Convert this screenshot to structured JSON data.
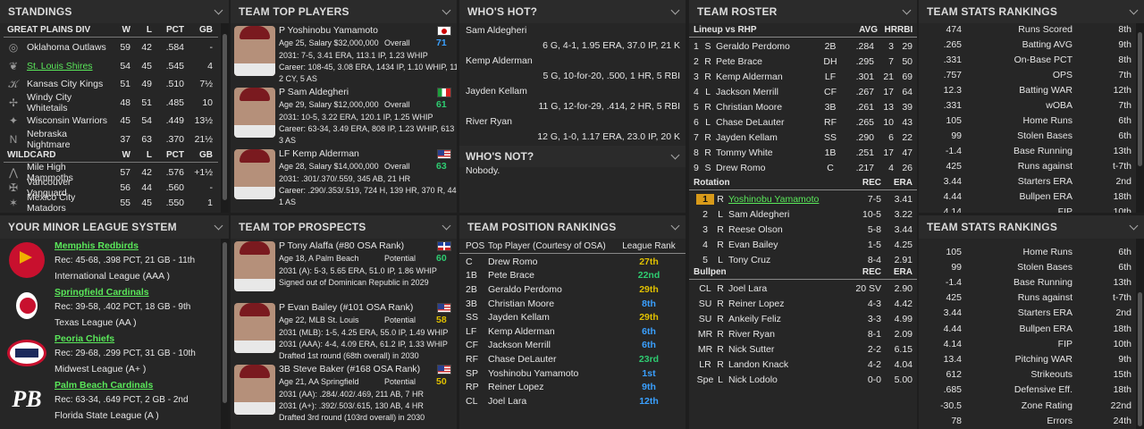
{
  "standings": {
    "title": "STANDINGS",
    "div_header": {
      "name": "GREAT PLAINS DIV",
      "w": "W",
      "l": "L",
      "pct": "PCT",
      "gb": "GB"
    },
    "div_rows": [
      {
        "team": "Oklahoma Outlaws",
        "w": "59",
        "l": "42",
        "pct": ".584",
        "gb": "-"
      },
      {
        "team": "St. Louis Shires",
        "w": "54",
        "l": "45",
        "pct": ".545",
        "gb": "4"
      },
      {
        "team": "Kansas City Kings",
        "w": "51",
        "l": "49",
        "pct": ".510",
        "gb": "7½"
      },
      {
        "team": "Windy City Whitetails",
        "w": "48",
        "l": "51",
        "pct": ".485",
        "gb": "10"
      },
      {
        "team": "Wisconsin Warriors",
        "w": "45",
        "l": "54",
        "pct": ".449",
        "gb": "13½"
      },
      {
        "team": "Nebraska Nightmare",
        "w": "37",
        "l": "63",
        "pct": ".370",
        "gb": "21½"
      }
    ],
    "wc_header": {
      "name": "WILDCARD",
      "w": "W",
      "l": "L",
      "pct": "PCT",
      "gb": "GB"
    },
    "wc_rows": [
      {
        "team": "Mile High Mammoths",
        "w": "57",
        "l": "42",
        "pct": ".576",
        "gb": "+1½"
      },
      {
        "team": "Vancouver Vanguard",
        "w": "56",
        "l": "44",
        "pct": ".560",
        "gb": "-"
      },
      {
        "team": "Mexico City Matadors",
        "w": "55",
        "l": "45",
        "pct": ".550",
        "gb": "1"
      }
    ]
  },
  "top_players": {
    "title": "TEAM TOP PLAYERS",
    "players": [
      {
        "name": "P Yoshinobu Yamamoto",
        "info": "Age 25, Salary $32,000,000",
        "ovl": "Overall",
        "rating": "71",
        "line1": "2031: 7-5, 3.41 ERA, 113.1 IP, 1.23 WHIP",
        "line2": "Career: 108-45, 3.08 ERA, 1434 IP, 1.10 WHIP, 1160",
        "line3": "2 CY, 5 AS"
      },
      {
        "name": "P Sam Aldegheri",
        "info": "Age 29, Salary $12,000,000",
        "ovl": "Overall",
        "rating": "61",
        "line1": "2031: 10-5, 3.22 ERA, 120.1 IP, 1.25 WHIP",
        "line2": "Career: 63-34, 3.49 ERA, 808 IP, 1.23 WHIP, 613 K",
        "line3": "3 AS"
      },
      {
        "name": "LF Kemp Alderman",
        "info": "Age 28, Salary $14,000,000",
        "ovl": "Overall",
        "rating": "63",
        "line1": "2031: .301/.370/.559, 345 AB, 21 HR",
        "line2": "Career: .290/.353/.519, 724 H, 139 HR, 370 R, 448 R",
        "line3": "1 AS"
      }
    ]
  },
  "whos_hot": {
    "title": "WHO'S HOT?",
    "entries": [
      {
        "name": "Sam Aldegheri",
        "stats": "6 G, 4-1, 1.95 ERA, 37.0 IP, 21 K"
      },
      {
        "name": "Kemp Alderman",
        "stats": "5 G, 10-for-20, .500, 1 HR, 5 RBI"
      },
      {
        "name": "Jayden Kellam",
        "stats": "11 G, 12-for-29, .414, 2 HR, 5 RBI"
      },
      {
        "name": "River Ryan",
        "stats": "12 G, 1-0, 1.17 ERA, 23.0 IP, 20 K"
      }
    ],
    "not_title": "WHO'S NOT?",
    "not_text": "Nobody."
  },
  "roster": {
    "title": "TEAM ROSTER",
    "lineup_header": {
      "label": "Lineup vs RHP",
      "avg": "AVG",
      "hr": "HR",
      "rbi": "RBI"
    },
    "lineup": [
      {
        "n": "1",
        "h": "S",
        "name": "Geraldo Perdomo",
        "pos": "2B",
        "avg": ".284",
        "hr": "3",
        "rbi": "29"
      },
      {
        "n": "2",
        "h": "R",
        "name": "Pete Brace",
        "pos": "DH",
        "avg": ".295",
        "hr": "7",
        "rbi": "50"
      },
      {
        "n": "3",
        "h": "R",
        "name": "Kemp Alderman",
        "pos": "LF",
        "avg": ".301",
        "hr": "21",
        "rbi": "69"
      },
      {
        "n": "4",
        "h": "L",
        "name": "Jackson Merrill",
        "pos": "CF",
        "avg": ".267",
        "hr": "17",
        "rbi": "64"
      },
      {
        "n": "5",
        "h": "R",
        "name": "Christian Moore",
        "pos": "3B",
        "avg": ".261",
        "hr": "13",
        "rbi": "39"
      },
      {
        "n": "6",
        "h": "L",
        "name": "Chase DeLauter",
        "pos": "RF",
        "avg": ".265",
        "hr": "10",
        "rbi": "43"
      },
      {
        "n": "7",
        "h": "R",
        "name": "Jayden Kellam",
        "pos": "SS",
        "avg": ".290",
        "hr": "6",
        "rbi": "22"
      },
      {
        "n": "8",
        "h": "R",
        "name": "Tommy White",
        "pos": "1B",
        "avg": ".251",
        "hr": "17",
        "rbi": "47"
      },
      {
        "n": "9",
        "h": "S",
        "name": "Drew Romo",
        "pos": "C",
        "avg": ".217",
        "hr": "4",
        "rbi": "26"
      }
    ],
    "rotation_header": {
      "label": "Rotation",
      "rec": "REC",
      "era": "ERA"
    },
    "rotation": [
      {
        "n": "1",
        "h": "R",
        "name": "Yoshinobu Yamamoto",
        "rec": "7-5",
        "era": "3.41"
      },
      {
        "n": "2",
        "h": "L",
        "name": "Sam Aldegheri",
        "rec": "10-5",
        "era": "3.22"
      },
      {
        "n": "3",
        "h": "R",
        "name": "Reese Olson",
        "rec": "5-8",
        "era": "3.44"
      },
      {
        "n": "4",
        "h": "R",
        "name": "Evan Bailey",
        "rec": "1-5",
        "era": "4.25"
      },
      {
        "n": "5",
        "h": "L",
        "name": "Tony Cruz",
        "rec": "8-4",
        "era": "2.91"
      }
    ],
    "bullpen_header": {
      "label": "Bullpen",
      "rec": "REC",
      "era": "ERA"
    },
    "bullpen": [
      {
        "n": "CL",
        "h": "R",
        "name": "Joel Lara",
        "rec": "20 SV",
        "era": "2.90"
      },
      {
        "n": "SU",
        "h": "R",
        "name": "Reiner Lopez",
        "rec": "4-3",
        "era": "4.42"
      },
      {
        "n": "SU",
        "h": "R",
        "name": "Ankeily Feliz",
        "rec": "3-3",
        "era": "4.99"
      },
      {
        "n": "MR",
        "h": "R",
        "name": "River Ryan",
        "rec": "8-1",
        "era": "2.09"
      },
      {
        "n": "MR",
        "h": "R",
        "name": "Nick Sutter",
        "rec": "2-2",
        "era": "6.15"
      },
      {
        "n": "LR",
        "h": "R",
        "name": "Landon Knack",
        "rec": "4-2",
        "era": "4.04"
      },
      {
        "n": "Spe",
        "h": "L",
        "name": "Nick Lodolo",
        "rec": "0-0",
        "era": "5.00"
      }
    ]
  },
  "stats_rank_top": {
    "title": "TEAM STATS RANKINGS",
    "rows": [
      {
        "v": "474",
        "s": "Runs Scored",
        "r": "8th"
      },
      {
        "v": ".265",
        "s": "Batting AVG",
        "r": "9th"
      },
      {
        "v": ".331",
        "s": "On-Base PCT",
        "r": "8th"
      },
      {
        "v": ".757",
        "s": "OPS",
        "r": "7th"
      },
      {
        "v": "12.3",
        "s": "Batting WAR",
        "r": "12th"
      },
      {
        "v": ".331",
        "s": "wOBA",
        "r": "7th"
      },
      {
        "v": "105",
        "s": "Home Runs",
        "r": "6th"
      },
      {
        "v": "99",
        "s": "Stolen Bases",
        "r": "6th"
      },
      {
        "v": "-1.4",
        "s": "Base Running",
        "r": "13th"
      },
      {
        "v": "425",
        "s": "Runs against",
        "r": "t-7th"
      },
      {
        "v": "3.44",
        "s": "Starters ERA",
        "r": "2nd"
      },
      {
        "v": "4.44",
        "s": "Bullpen ERA",
        "r": "18th"
      },
      {
        "v": "4.14",
        "s": "FIP",
        "r": "10th"
      }
    ]
  },
  "stats_rank_bottom": {
    "title": "TEAM STATS RANKINGS",
    "rows": [
      {
        "v": "105",
        "s": "Home Runs",
        "r": "6th"
      },
      {
        "v": "99",
        "s": "Stolen Bases",
        "r": "6th"
      },
      {
        "v": "-1.4",
        "s": "Base Running",
        "r": "13th"
      },
      {
        "v": "425",
        "s": "Runs against",
        "r": "t-7th"
      },
      {
        "v": "3.44",
        "s": "Starters ERA",
        "r": "2nd"
      },
      {
        "v": "4.44",
        "s": "Bullpen ERA",
        "r": "18th"
      },
      {
        "v": "4.14",
        "s": "FIP",
        "r": "10th"
      },
      {
        "v": "13.4",
        "s": "Pitching WAR",
        "r": "9th"
      },
      {
        "v": "612",
        "s": "Strikeouts",
        "r": "15th"
      },
      {
        "v": ".685",
        "s": "Defensive Eff.",
        "r": "18th"
      },
      {
        "v": "-30.5",
        "s": "Zone Rating",
        "r": "22nd"
      },
      {
        "v": "78",
        "s": "Errors",
        "r": "24th"
      }
    ]
  },
  "minors": {
    "title": "YOUR MINOR LEAGUE SYSTEM",
    "teams": [
      {
        "name": "Memphis Redbirds",
        "rec": "Rec: 45-68, .398 PCT, 21 GB - 11th",
        "league": "International League (AAA )",
        "logo": "redbird-logo"
      },
      {
        "name": "Springfield Cardinals",
        "rec": "Rec: 39-58, .402 PCT, 18 GB - 9th",
        "league": "Texas League (AA )",
        "logo": "cardinal-logo"
      },
      {
        "name": "Peoria Chiefs",
        "rec": "Rec: 29-68, .299 PCT, 31 GB - 10th",
        "league": "Midwest League (A+ )",
        "logo": "chiefs-logo"
      },
      {
        "name": "Palm Beach Cardinals",
        "rec": "Rec: 63-34, .649 PCT, 2 GB - 2nd",
        "league": "Florida State League (A )",
        "logo": "pb-logo"
      }
    ]
  },
  "prospects": {
    "title": "TEAM TOP PROSPECTS",
    "players": [
      {
        "name": "P Tony Alaffa (#80 OSA Rank)",
        "info": "Age 18, A Palm Beach",
        "pot": "Potential",
        "rating": "60",
        "line1": "2031 (A): 5-3, 5.65 ERA, 51.0 IP, 1.86 WHIP",
        "line2": "Signed out of Dominican Republic in 2029"
      },
      {
        "name": "P Evan Bailey (#101 OSA Rank)",
        "info": "Age 22, MLB St. Louis",
        "pot": "Potential",
        "rating": "58",
        "line1": "2031 (MLB): 1-5, 4.25 ERA, 55.0 IP, 1.49 WHIP",
        "line2": "2031 (AAA): 4-4, 4.09 ERA, 61.2 IP, 1.33 WHIP",
        "line3": "Drafted 1st round (68th overall) in 2030"
      },
      {
        "name": "3B Steve Baker (#168 OSA Rank)",
        "info": "Age 21, AA Springfield",
        "pot": "Potential",
        "rating": "50",
        "line1": "2031 (AA): .284/.402/.469, 211 AB, 7 HR",
        "line2": "2031 (A+): .392/.503/.615, 130 AB, 4 HR",
        "line3": "Drafted 3rd round (103rd overall) in 2030"
      }
    ]
  },
  "pos_rank": {
    "title": "TEAM POSITION RANKINGS",
    "header": {
      "pos": "POS",
      "player": "Top Player (Courtesy of OSA)",
      "rank": "League Rank"
    },
    "rows": [
      {
        "pos": "C",
        "player": "Drew Romo",
        "rank": "27th",
        "c": "#e0c000"
      },
      {
        "pos": "1B",
        "player": "Pete Brace",
        "rank": "22nd",
        "c": "#2ecc71"
      },
      {
        "pos": "2B",
        "player": "Geraldo Perdomo",
        "rank": "29th",
        "c": "#e0c000"
      },
      {
        "pos": "3B",
        "player": "Christian Moore",
        "rank": "8th",
        "c": "#3aa0ff"
      },
      {
        "pos": "SS",
        "player": "Jayden Kellam",
        "rank": "29th",
        "c": "#e0c000"
      },
      {
        "pos": "LF",
        "player": "Kemp Alderman",
        "rank": "6th",
        "c": "#3aa0ff"
      },
      {
        "pos": "CF",
        "player": "Jackson Merrill",
        "rank": "6th",
        "c": "#3aa0ff"
      },
      {
        "pos": "RF",
        "player": "Chase DeLauter",
        "rank": "23rd",
        "c": "#2ecc71"
      },
      {
        "pos": "SP",
        "player": "Yoshinobu Yamamoto",
        "rank": "1st",
        "c": "#3aa0ff"
      },
      {
        "pos": "RP",
        "player": "Reiner Lopez",
        "rank": "9th",
        "c": "#3aa0ff"
      },
      {
        "pos": "CL",
        "player": "Joel Lara",
        "rank": "12th",
        "c": "#3aa0ff"
      }
    ]
  }
}
